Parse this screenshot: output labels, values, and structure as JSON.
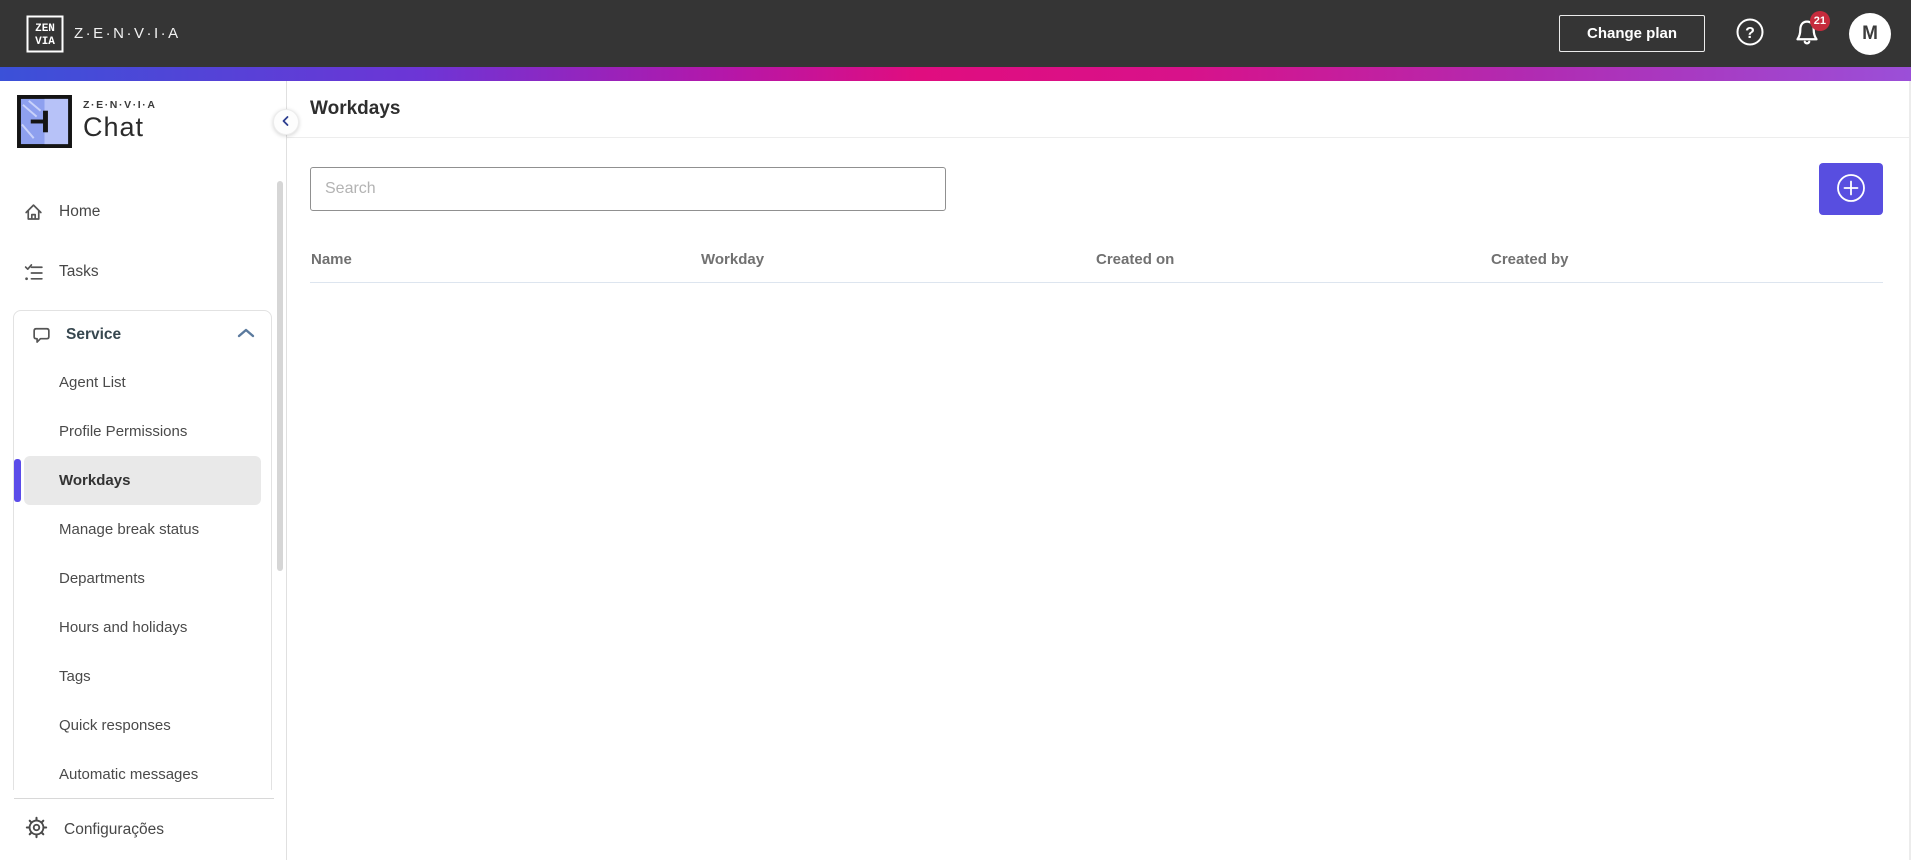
{
  "topbar": {
    "brand": "Z·E·N·V·I·A",
    "change_plan_label": "Change plan",
    "notification_count": "21",
    "avatar_initial": "M"
  },
  "sidebar": {
    "logo_brand": "Z·E·N·V·I·A",
    "logo_product": "Chat",
    "items": [
      {
        "label": "Home",
        "icon": "home-icon"
      },
      {
        "label": "Tasks",
        "icon": "tasks-icon"
      }
    ],
    "service_section": {
      "label": "Service",
      "icon": "chat-bubble-icon",
      "expanded": true,
      "children": [
        {
          "label": "Agent List",
          "selected": false
        },
        {
          "label": "Profile Permissions",
          "selected": false
        },
        {
          "label": "Workdays",
          "selected": true
        },
        {
          "label": "Manage break status",
          "selected": false
        },
        {
          "label": "Departments",
          "selected": false
        },
        {
          "label": "Hours and holidays",
          "selected": false
        },
        {
          "label": "Tags",
          "selected": false
        },
        {
          "label": "Quick responses",
          "selected": false
        },
        {
          "label": "Automatic messages",
          "selected": false
        }
      ]
    },
    "footer_item": {
      "label": "Configurações",
      "icon": "gear-icon"
    }
  },
  "main": {
    "page_title": "Workdays",
    "search_placeholder": "Search",
    "table": {
      "columns": [
        "Name",
        "Workday",
        "Created on",
        "Created by"
      ],
      "rows": []
    }
  },
  "colors": {
    "topbar_bg": "#353535",
    "accent": "#584ee0",
    "selected_bar": "#5b4ce9",
    "badge_red": "#c62b3d",
    "gradient": [
      "#3b51d8",
      "#6d35d6",
      "#e00d7f",
      "#d8128a",
      "#9b4fd8"
    ]
  }
}
